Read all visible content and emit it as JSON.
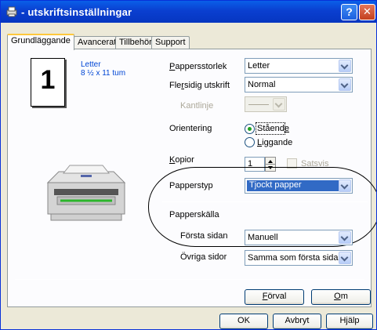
{
  "window": {
    "title": "- utskriftsinställningar",
    "help_glyph": "?",
    "close_glyph": "✕"
  },
  "tabs": [
    {
      "label": "Grundläggande",
      "active": true
    },
    {
      "label": "Avancerat"
    },
    {
      "label": "Tillbehör"
    },
    {
      "label": "Support"
    }
  ],
  "preview": {
    "copies_number": "1",
    "paper_name": "Letter",
    "paper_dims": "8 ½ x 11 tum"
  },
  "fields": {
    "paper_size": {
      "label_u": "P",
      "label_rest": "appersstorlek",
      "value": "Letter"
    },
    "multipage": {
      "label_pre": "Fle",
      "label_u": "r",
      "label_rest": "sidig utskrift",
      "value": "Normal"
    },
    "border": {
      "label": "Kantlinje"
    },
    "orientation": {
      "label": "Orientering",
      "portrait_pre": "Ståend",
      "portrait_u": "e",
      "landscape_u": "L",
      "landscape_rest": "iggande",
      "selected": "portrait"
    },
    "copies": {
      "label_u": "K",
      "label_rest": "opior",
      "value": "1",
      "collate_label": "Satsvis"
    },
    "media_type": {
      "label": "Papperstyp",
      "value": "Tjockt papper"
    },
    "paper_source": {
      "label": "Papperskälla"
    },
    "first_page": {
      "label": "Första sidan",
      "value": "Manuell"
    },
    "other_pages": {
      "label": "Övriga sidor",
      "value": "Samma som första sidan"
    }
  },
  "buttons": {
    "default_u": "F",
    "default_rest": "örval",
    "about_u": "O",
    "about_rest": "m",
    "ok": "OK",
    "cancel": "Avbryt",
    "help": "Hjälp"
  },
  "colors": {
    "titlebar": "#0a3fd0",
    "selection": "#316ac5",
    "link_text": "#0046d5",
    "radio_dot": "#21a121"
  }
}
